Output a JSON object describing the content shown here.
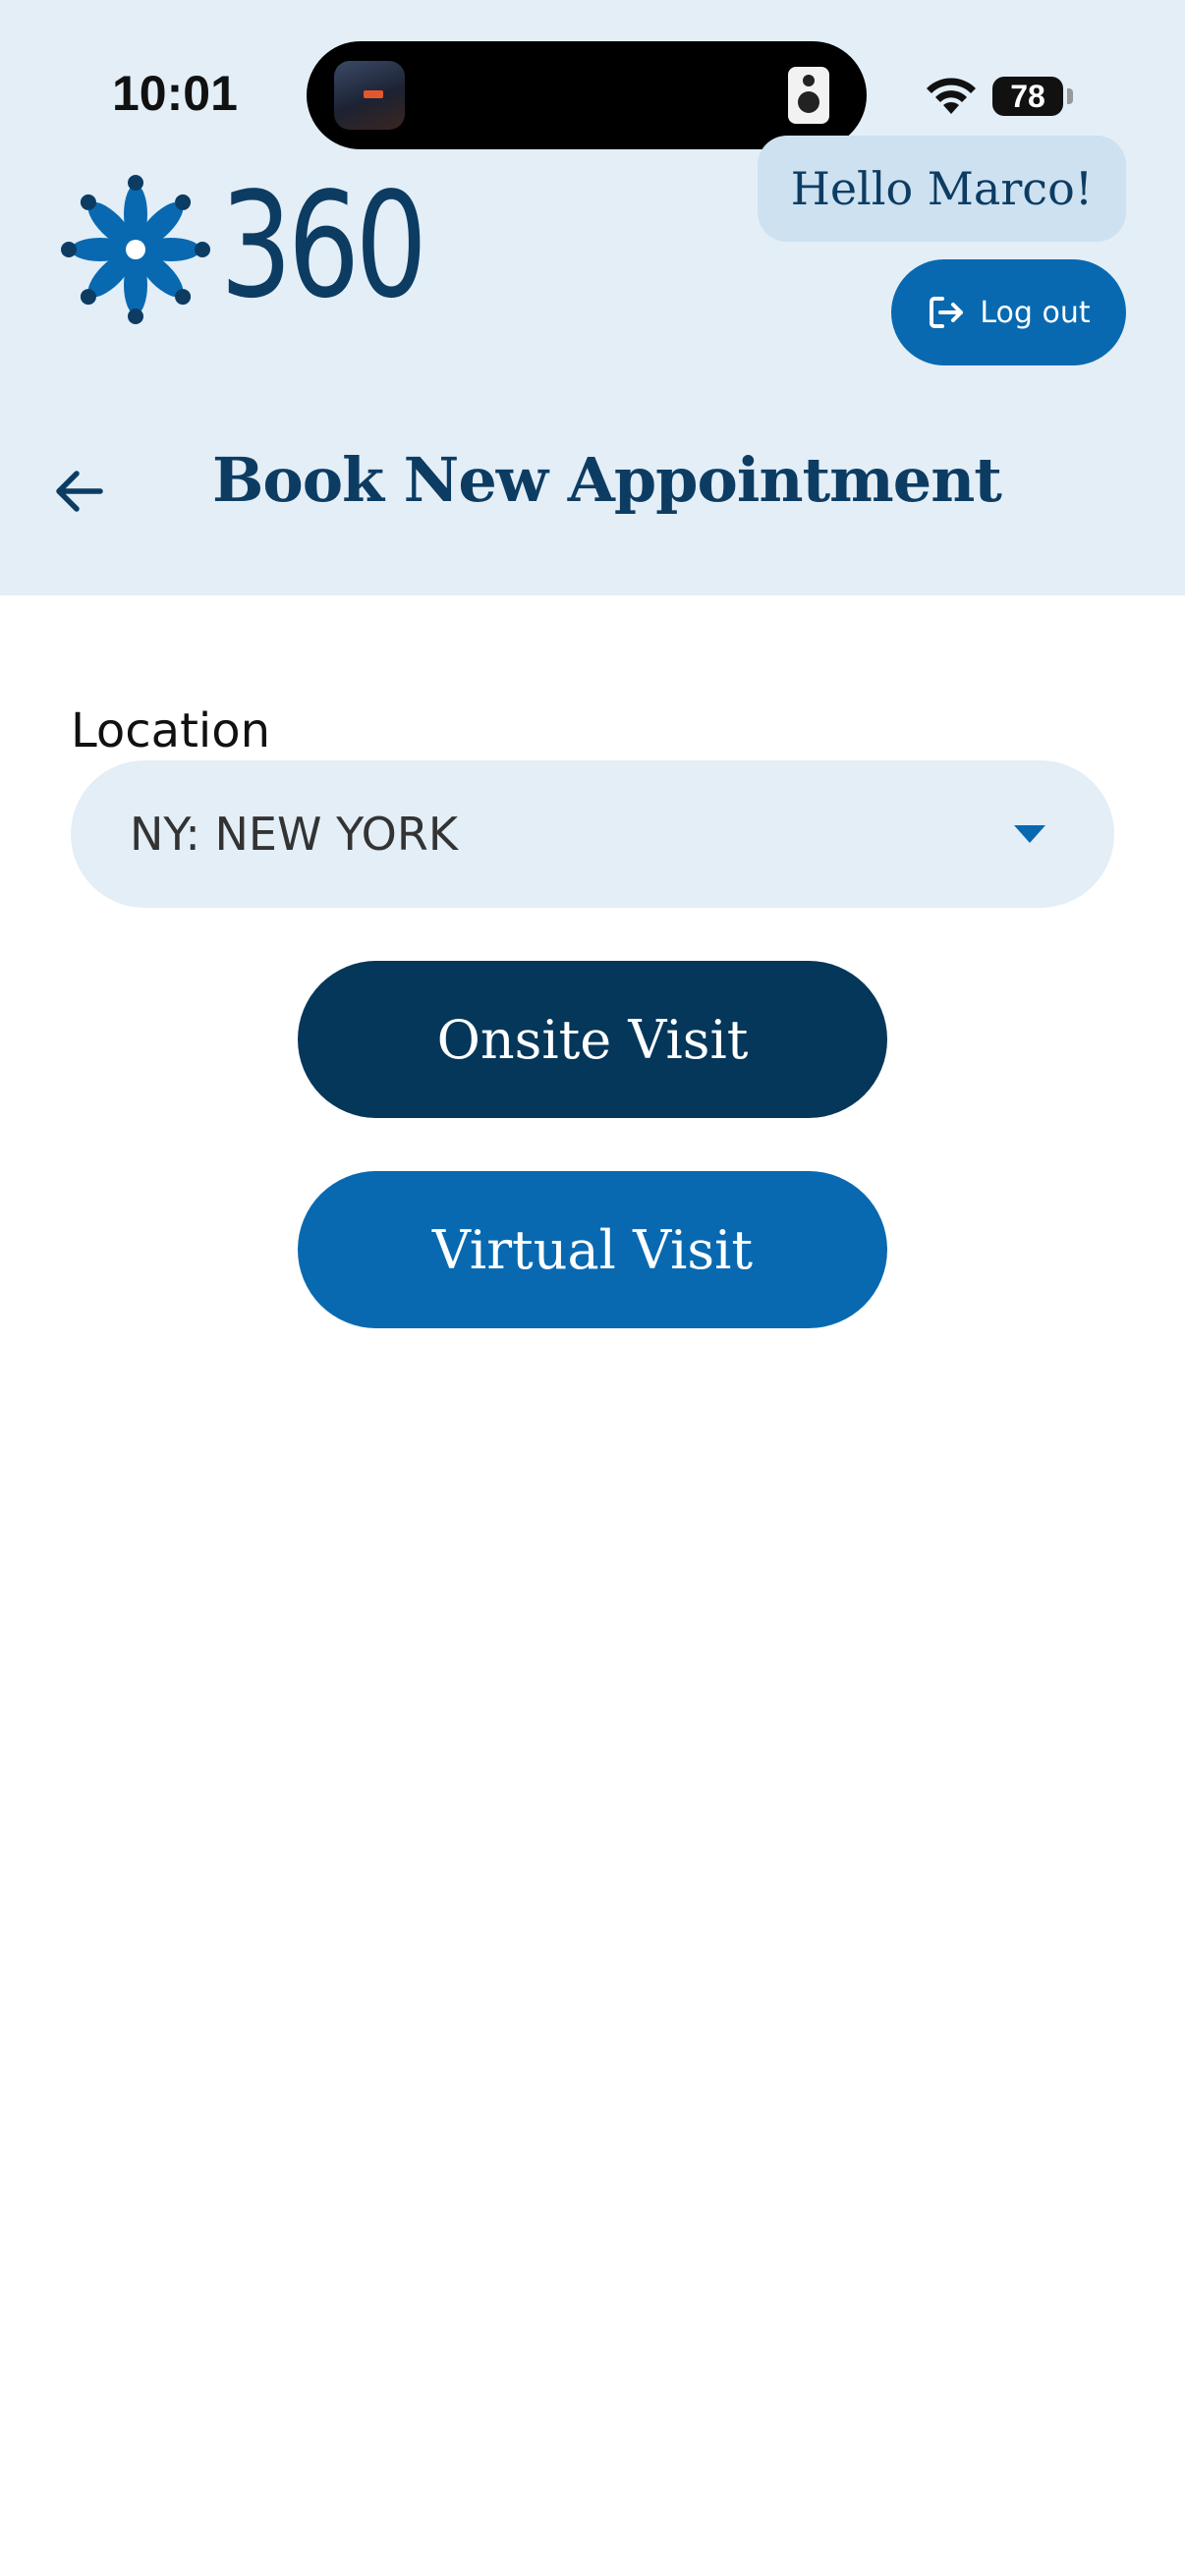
{
  "status_bar": {
    "time": "10:01",
    "battery": "78"
  },
  "header": {
    "brand": "360",
    "greeting": "Hello Marco!",
    "logout_label": "Log out",
    "title": "Book New Appointment"
  },
  "form": {
    "location_label": "Location",
    "location_value": "NY: NEW YORK"
  },
  "actions": {
    "onsite_label": "Onsite Visit",
    "virtual_label": "Virtual Visit"
  },
  "icons": {
    "back": "arrow-left-icon",
    "logout": "logout-icon",
    "dropdown": "caret-down-icon",
    "brand": "snowflake-logo-icon"
  },
  "colors": {
    "header_bg": "#e3eef7",
    "brand_navy": "#0d3c63",
    "primary_blue": "#0869b1",
    "dark_navy": "#04375a"
  }
}
